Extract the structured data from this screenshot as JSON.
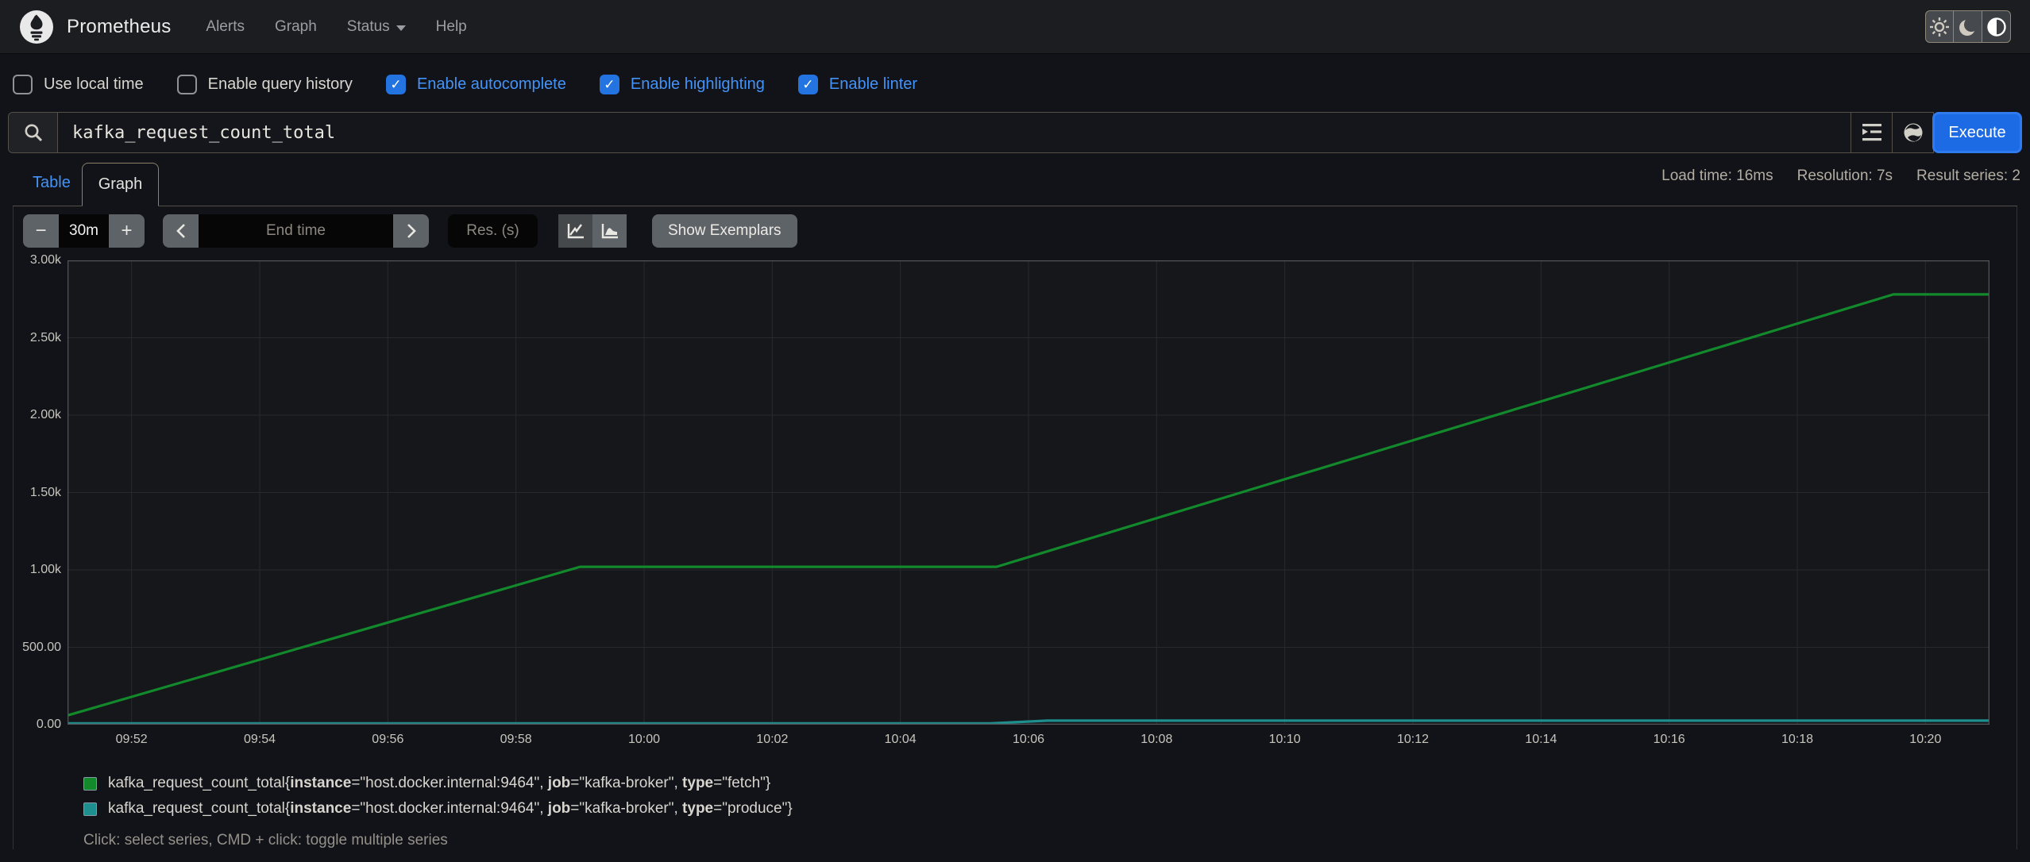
{
  "navbar": {
    "brand": "Prometheus",
    "links": [
      {
        "label": "Alerts",
        "dropdown": false
      },
      {
        "label": "Graph",
        "dropdown": false
      },
      {
        "label": "Status",
        "dropdown": true
      },
      {
        "label": "Help",
        "dropdown": false
      }
    ],
    "theme_buttons": [
      {
        "icon": "sun-icon",
        "active": false
      },
      {
        "icon": "moon-icon",
        "active": false
      },
      {
        "icon": "auto-contrast-icon",
        "active": true
      }
    ]
  },
  "options": {
    "items": [
      {
        "label": "Use local time",
        "checked": false
      },
      {
        "label": "Enable query history",
        "checked": false
      },
      {
        "label": "Enable autocomplete",
        "checked": true
      },
      {
        "label": "Enable highlighting",
        "checked": true
      },
      {
        "label": "Enable linter",
        "checked": true
      }
    ]
  },
  "query": {
    "value": "kafka_request_count_total",
    "execute_label": "Execute",
    "icons": [
      "search-icon",
      "metrics-explorer-icon",
      "globe-icon"
    ]
  },
  "stats": [
    "Load time: 16ms",
    "Resolution: 7s",
    "Result series: 2"
  ],
  "tabs": {
    "table": "Table",
    "graph": "Graph"
  },
  "controls": {
    "minus_label": "−",
    "range_value": "30m",
    "plus_label": "+",
    "end_time_placeholder": "End time",
    "res_placeholder": "Res. (s)",
    "show_exemplars_label": "Show Exemplars"
  },
  "chart_data": {
    "type": "line",
    "title": "kafka_request_count_total",
    "grid": true,
    "legend_position": "bottom",
    "ylim": [
      0,
      3000
    ],
    "x_range_minutes": [
      591,
      621
    ],
    "y_ticks": [
      {
        "label": "0.00",
        "v": 0
      },
      {
        "label": "500.00",
        "v": 500
      },
      {
        "label": "1.00k",
        "v": 1000
      },
      {
        "label": "1.50k",
        "v": 1500
      },
      {
        "label": "2.00k",
        "v": 2000
      },
      {
        "label": "2.50k",
        "v": 2500
      },
      {
        "label": "3.00k",
        "v": 3000
      }
    ],
    "x_ticks": [
      {
        "label": "09:52",
        "t": 592
      },
      {
        "label": "09:54",
        "t": 594
      },
      {
        "label": "09:56",
        "t": 596
      },
      {
        "label": "09:58",
        "t": 598
      },
      {
        "label": "10:00",
        "t": 600
      },
      {
        "label": "10:02",
        "t": 602
      },
      {
        "label": "10:04",
        "t": 604
      },
      {
        "label": "10:06",
        "t": 606
      },
      {
        "label": "10:08",
        "t": 608
      },
      {
        "label": "10:10",
        "t": 610
      },
      {
        "label": "10:12",
        "t": 612
      },
      {
        "label": "10:14",
        "t": 614
      },
      {
        "label": "10:16",
        "t": 616
      },
      {
        "label": "10:18",
        "t": 618
      },
      {
        "label": "10:20",
        "t": 620
      }
    ],
    "series": [
      {
        "name": "kafka_request_count_total",
        "labels": {
          "instance": "host.docker.internal:9464",
          "job": "kafka-broker",
          "type": "fetch"
        },
        "color": "#128a2c",
        "points": [
          [
            591,
            60
          ],
          [
            599,
            1020
          ],
          [
            605.5,
            1020
          ],
          [
            619.5,
            2780
          ],
          [
            621,
            2780
          ]
        ]
      },
      {
        "name": "kafka_request_count_total",
        "labels": {
          "instance": "host.docker.internal:9464",
          "job": "kafka-broker",
          "type": "produce"
        },
        "color": "#1d8f8f",
        "points": [
          [
            591,
            8
          ],
          [
            605.4,
            8
          ],
          [
            606.3,
            26
          ],
          [
            621,
            26
          ]
        ]
      }
    ]
  },
  "legend_hint": "Click: select series, CMD + click: toggle multiple series",
  "colors": {
    "accent_blue": "#2374e1",
    "link_blue": "#4493f8",
    "execute_blue": "#1d6be4",
    "series_green": "#128a2c",
    "series_teal": "#1d8f8f",
    "plot_border": "#505256",
    "grid": "#27292d"
  }
}
